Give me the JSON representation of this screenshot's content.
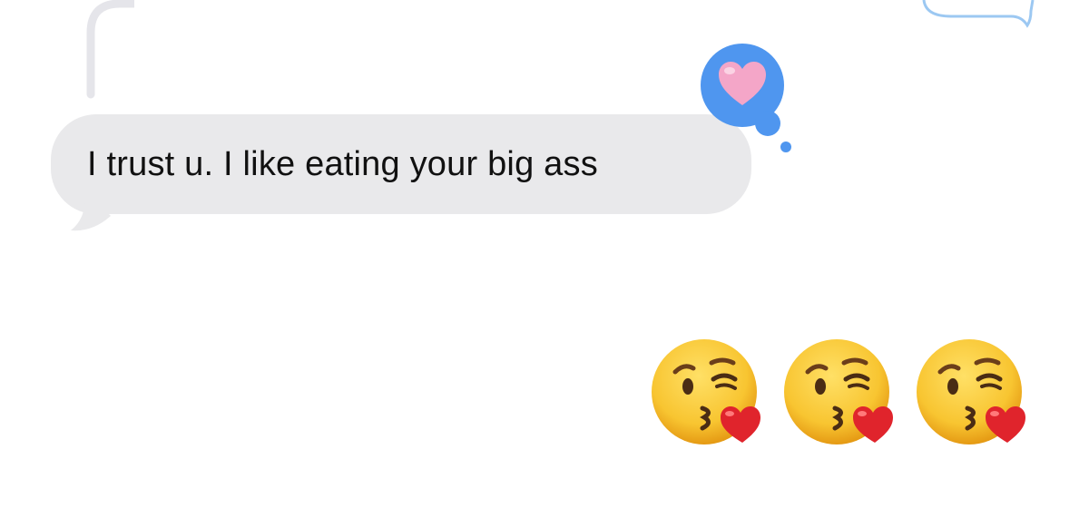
{
  "message": {
    "text": "I trust u. I like eating your big ass",
    "direction": "incoming",
    "bubble_color": "#e9e9eb"
  },
  "tapback": {
    "icon": "pink-heart-icon",
    "bubble_color": "#4f96ef",
    "heart_color": "#f4a6c8"
  },
  "reply": {
    "emojis": [
      "kissing-face-with-heart-icon",
      "kissing-face-with-heart-icon",
      "kissing-face-with-heart-icon"
    ],
    "direction": "outgoing"
  },
  "top_outgoing_bubble": {
    "border_color": "#9cc8f2"
  },
  "thread_line_color": "#e5e5ea"
}
